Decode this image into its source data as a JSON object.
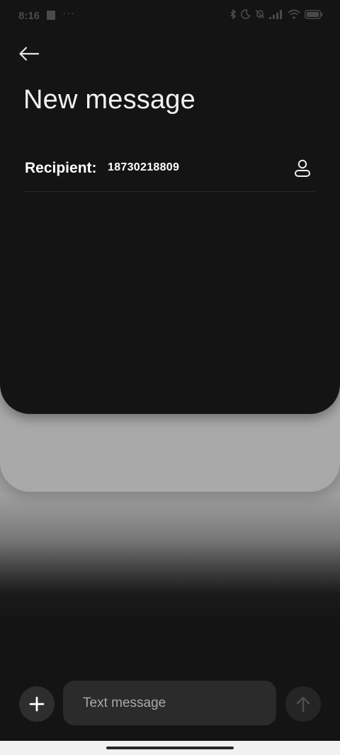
{
  "status_bar": {
    "time": "8:16",
    "overflow": "···",
    "icons": [
      "bluetooth-icon",
      "moon-icon",
      "bell-off-icon",
      "signal-icon",
      "wifi-icon",
      "battery-icon"
    ]
  },
  "header": {
    "back_icon": "arrow-left-icon",
    "title": "New message"
  },
  "recipient": {
    "label": "Recipient:",
    "number": "18730218809",
    "contact_icon": "person-icon"
  },
  "composer": {
    "add_icon": "plus-icon",
    "placeholder": "Text message",
    "value": "",
    "send_icon": "arrow-up-icon"
  },
  "colors": {
    "background": "#141414",
    "input_bg": "#2b2b2b",
    "card_gray": "#a9a9a9",
    "nav_bar": "#f1f1f1"
  }
}
